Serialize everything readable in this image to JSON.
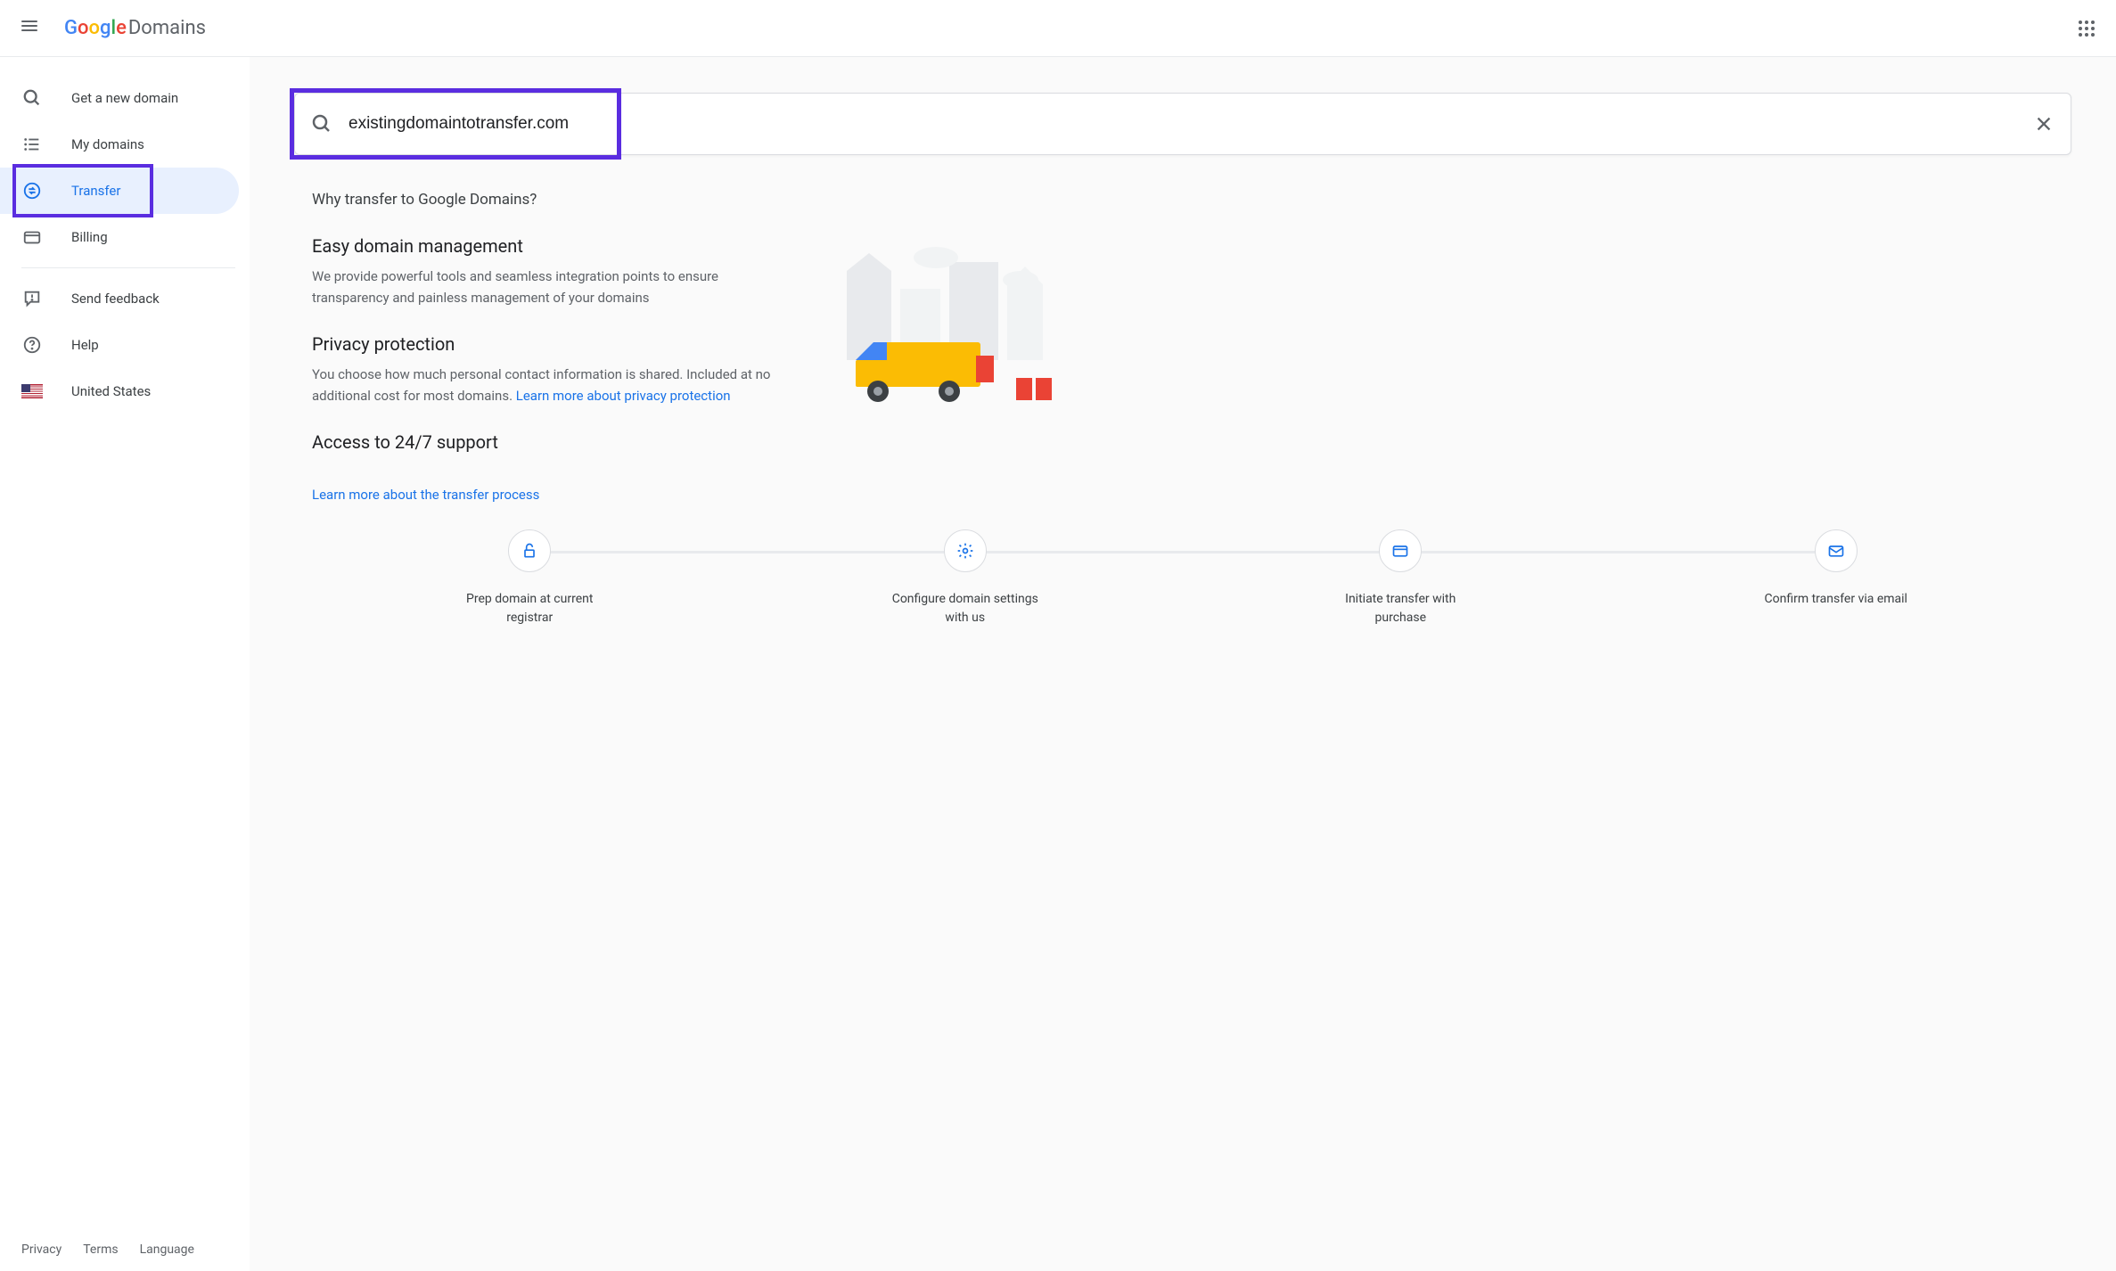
{
  "header": {
    "product": "Domains"
  },
  "sidebar": {
    "items": [
      {
        "label": "Get a new domain"
      },
      {
        "label": "My domains"
      },
      {
        "label": "Transfer"
      },
      {
        "label": "Billing"
      },
      {
        "label": "Send feedback"
      },
      {
        "label": "Help"
      },
      {
        "label": "United States"
      }
    ]
  },
  "search": {
    "value": "existingdomaintotransfer.com"
  },
  "content": {
    "why_title": "Why transfer to Google Domains?",
    "features": [
      {
        "title": "Easy domain management",
        "desc": "We provide powerful tools and seamless integration points to ensure transparency and painless management of your domains"
      },
      {
        "title": "Privacy protection",
        "desc": "You choose how much personal contact information is shared. Included at no additional cost for most domains. ",
        "link": "Learn more about privacy protection"
      },
      {
        "title": "Access to 24/7 support",
        "desc": ""
      }
    ],
    "learn_more": "Learn more about the transfer process",
    "steps": [
      {
        "label": "Prep domain at current registrar"
      },
      {
        "label": "Configure domain settings with us"
      },
      {
        "label": "Initiate transfer with purchase"
      },
      {
        "label": "Confirm transfer via email"
      }
    ]
  },
  "footer": {
    "privacy": "Privacy",
    "terms": "Terms",
    "language": "Language"
  }
}
